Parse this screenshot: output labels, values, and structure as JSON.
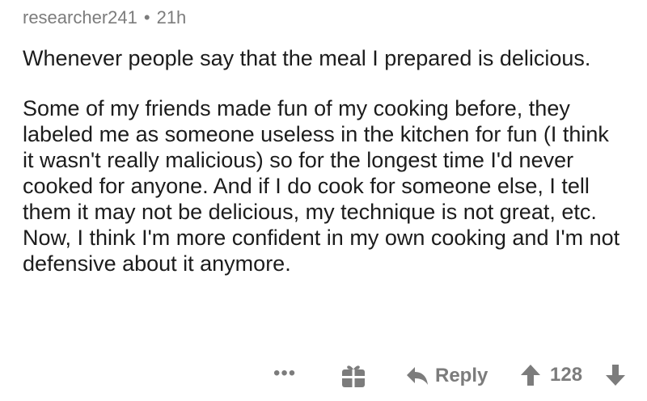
{
  "comment": {
    "author": "researcher241",
    "separator": "•",
    "age": "21h",
    "paragraphs": [
      "Whenever people say that the meal I prepared is delicious.",
      "Some of my friends made fun of my cooking before, they labeled me as someone useless in the kitchen for fun (I think it wasn't really malicious) so for the longest time I'd never cooked for anyone. And if I do cook for someone else, I tell them it may not be delicious, my technique is not great, etc. Now, I think I'm more confident in my own cooking and I'm not defensive about it anymore."
    ]
  },
  "actions": {
    "more_label": "•••",
    "reply_label": "Reply",
    "score": "128"
  },
  "icons": {
    "more": "more-options-icon",
    "gift": "gift-award-icon",
    "reply": "reply-arrow-icon",
    "upvote": "upvote-arrow-icon",
    "downvote": "downvote-arrow-icon"
  },
  "colors": {
    "text": "#1c1c1c",
    "meta": "#7c7c7c",
    "background": "#ffffff"
  }
}
